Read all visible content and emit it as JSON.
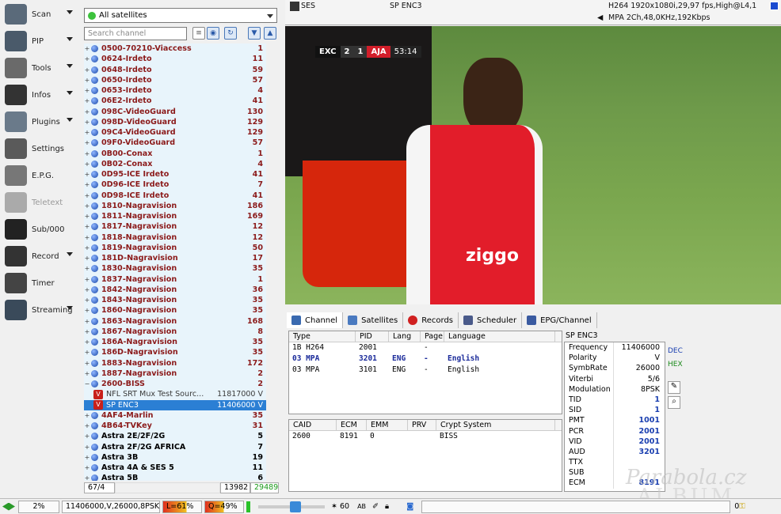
{
  "left_menu": [
    {
      "label": "Scan",
      "icon": "satellite-dish-icon",
      "arrow": true
    },
    {
      "label": "PIP",
      "icon": "pip-icon",
      "arrow": true
    },
    {
      "label": "Tools",
      "icon": "tools-icon",
      "arrow": true
    },
    {
      "label": "Infos",
      "icon": "info-icon",
      "arrow": true
    },
    {
      "label": "Plugins",
      "icon": "plugins-icon",
      "arrow": true
    },
    {
      "label": "Settings",
      "icon": "gear-icon",
      "arrow": false
    },
    {
      "label": "E.P.G.",
      "icon": "epg-icon",
      "arrow": false
    },
    {
      "label": "Teletext",
      "icon": "teletext-icon",
      "arrow": false
    },
    {
      "label": "Sub/000",
      "icon": "subtitle-icon",
      "arrow": false
    },
    {
      "label": "Record",
      "icon": "record-icon",
      "arrow": true
    },
    {
      "label": "Timer",
      "icon": "timer-icon",
      "arrow": false
    },
    {
      "label": "Streaming",
      "icon": "streaming-icon",
      "arrow": true
    }
  ],
  "satellite_select": "All satellites",
  "search_placeholder": "Search channel",
  "channel_rows": [
    {
      "t": "g",
      "n": "0500-70210-Viaccess",
      "c": "1"
    },
    {
      "t": "g",
      "n": "0624-Irdeto",
      "c": "11"
    },
    {
      "t": "g",
      "n": "0648-Irdeto",
      "c": "59"
    },
    {
      "t": "g",
      "n": "0650-Irdeto",
      "c": "57"
    },
    {
      "t": "g",
      "n": "0653-Irdeto",
      "c": "4"
    },
    {
      "t": "g",
      "n": "06E2-Irdeto",
      "c": "41"
    },
    {
      "t": "g",
      "n": "098C-VideoGuard",
      "c": "130"
    },
    {
      "t": "g",
      "n": "098D-VideoGuard",
      "c": "129"
    },
    {
      "t": "g",
      "n": "09C4-VideoGuard",
      "c": "129"
    },
    {
      "t": "g",
      "n": "09F0-VideoGuard",
      "c": "57"
    },
    {
      "t": "g",
      "n": "0B00-Conax",
      "c": "1"
    },
    {
      "t": "g",
      "n": "0B02-Conax",
      "c": "4"
    },
    {
      "t": "g",
      "n": "0D95-ICE Irdeto",
      "c": "41"
    },
    {
      "t": "g",
      "n": "0D96-ICE Irdeto",
      "c": "7"
    },
    {
      "t": "g",
      "n": "0D98-ICE Irdeto",
      "c": "41"
    },
    {
      "t": "g",
      "n": "1810-Nagravision",
      "c": "186"
    },
    {
      "t": "g",
      "n": "1811-Nagravision",
      "c": "169"
    },
    {
      "t": "g",
      "n": "1817-Nagravision",
      "c": "12"
    },
    {
      "t": "g",
      "n": "1818-Nagravision",
      "c": "12"
    },
    {
      "t": "g",
      "n": "1819-Nagravision",
      "c": "50"
    },
    {
      "t": "g",
      "n": "181D-Nagravision",
      "c": "17"
    },
    {
      "t": "g",
      "n": "1830-Nagravision",
      "c": "35"
    },
    {
      "t": "g",
      "n": "1837-Nagravision",
      "c": "1"
    },
    {
      "t": "g",
      "n": "1842-Nagravision",
      "c": "36"
    },
    {
      "t": "g",
      "n": "1843-Nagravision",
      "c": "35"
    },
    {
      "t": "g",
      "n": "1860-Nagravision",
      "c": "35"
    },
    {
      "t": "g",
      "n": "1863-Nagravision",
      "c": "168"
    },
    {
      "t": "g",
      "n": "1867-Nagravision",
      "c": "8"
    },
    {
      "t": "g",
      "n": "186A-Nagravision",
      "c": "35"
    },
    {
      "t": "g",
      "n": "186D-Nagravision",
      "c": "35"
    },
    {
      "t": "g",
      "n": "1883-Nagravision",
      "c": "172"
    },
    {
      "t": "g",
      "n": "1887-Nagravision",
      "c": "2"
    },
    {
      "t": "g",
      "n": "2600-BISS",
      "c": "2",
      "open": true
    },
    {
      "t": "c",
      "n": "NFL SRT Mux Test Sourc...",
      "c": "11817000 V"
    },
    {
      "t": "c",
      "n": "SP ENC3",
      "c": "11406000 V",
      "sel": true
    },
    {
      "t": "g",
      "n": "4AF4-Marlin",
      "c": "35"
    },
    {
      "t": "g",
      "n": "4B64-TVKey",
      "c": "31"
    },
    {
      "t": "s",
      "n": "Astra 2E/2F/2G",
      "c": "5"
    },
    {
      "t": "s",
      "n": "Astra 2F/2G AFRICA",
      "c": "7"
    },
    {
      "t": "s",
      "n": "Astra 3B",
      "c": "19"
    },
    {
      "t": "s",
      "n": "Astra 4A & SES 5",
      "c": "11"
    },
    {
      "t": "s",
      "n": "Astra 5B",
      "c": "6"
    }
  ],
  "list_status": {
    "pos": "67/4",
    "total": "13982",
    "green": "29489"
  },
  "top": {
    "sat": "SES",
    "channel": "SP ENC3",
    "video": "H264 1920x1080i,29,97 fps,High@L4,1",
    "audio": "MPA 2Ch,48,0KHz,192Kbps"
  },
  "scoreboard": {
    "home": "EXC",
    "home_score": "2",
    "away_score": "1",
    "away": "AJA",
    "time": "53:14"
  },
  "tabs": [
    "Channel",
    "Satellites",
    "Records",
    "Scheduler",
    "EPG/Channel"
  ],
  "streams": {
    "headers": [
      "Type",
      "PID",
      "Lang",
      "Page",
      "Language"
    ],
    "rows": [
      [
        "1B H264",
        "2001",
        "",
        "-",
        ""
      ],
      [
        "03 MPA",
        "3201",
        "ENG",
        "-",
        "English"
      ],
      [
        "03 MPA",
        "3101",
        "ENG",
        "-",
        "English"
      ]
    ]
  },
  "caids": {
    "headers": [
      "CAID",
      "ECM",
      "EMM",
      "PRV",
      "Crypt System"
    ],
    "rows": [
      [
        "2600",
        "8191",
        "0",
        "",
        "BISS"
      ]
    ]
  },
  "info": {
    "title": "SP ENC3",
    "rows": [
      [
        "Frequency",
        "11406000",
        false
      ],
      [
        "Polarity",
        "V",
        false
      ],
      [
        "SymbRate",
        "26000",
        false
      ],
      [
        "Viterbi",
        "5/6",
        false
      ],
      [
        "Modulation",
        "8PSK",
        false
      ],
      [
        "TID",
        "1",
        true
      ],
      [
        "SID",
        "1",
        true
      ],
      [
        "PMT",
        "1001",
        true
      ],
      [
        "PCR",
        "2001",
        true
      ],
      [
        "VID",
        "2001",
        true
      ],
      [
        "AUD",
        "3201",
        true
      ],
      [
        "TTX",
        "",
        false
      ],
      [
        "SUB",
        "",
        false
      ],
      [
        "ECM",
        "8191",
        true
      ]
    ]
  },
  "side_labels": {
    "dec": "DEC",
    "hex": "HEX"
  },
  "statusbar": {
    "pct": "2%",
    "tp": "11406000,V,26000,8PSK",
    "level": "L=61%",
    "quality": "Q=49%",
    "volume": "60",
    "last": "0"
  },
  "watermark": {
    "line1": "Parabola.cz",
    "line2": "ALBUM"
  }
}
